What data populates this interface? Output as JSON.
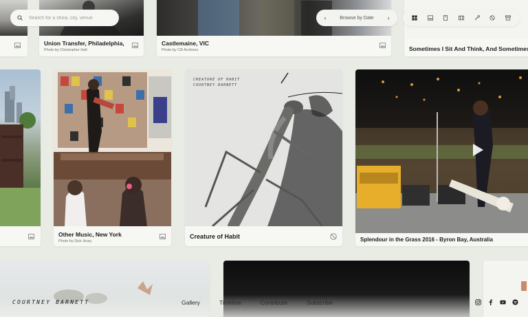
{
  "search": {
    "placeholder": "Search for a show, city, venue",
    "icon": "search-icon"
  },
  "date_nav": {
    "label": "Browse by Date",
    "prev": "‹",
    "next": "›"
  },
  "view_toolbar": [
    "grid-view-icon",
    "image-icon",
    "document-icon",
    "video-icon",
    "pen-icon",
    "no-icon",
    "archive-icon"
  ],
  "cards": {
    "union": {
      "title": "Union Transfer, Philadelphia, PA",
      "credit": "Photo by Christopher Hall"
    },
    "castlemaine": {
      "title": "Castlemaine, VIC",
      "credit": "Photo by CB Archives"
    },
    "sometimes": {
      "title": "Sometimes I Sit And Think, And Sometimes I Just Sit"
    },
    "othermusic": {
      "title": "Other Music, New York",
      "credit": "Photo by Dick Huey"
    },
    "creature": {
      "title": "Creature of Habit",
      "art_text_1": "CREATURE OF HABIT",
      "art_text_2": "COURTNEY BARNETT"
    },
    "splendour": {
      "title": "Splendour in the Grass 2016 - Byron Bay, Australia"
    }
  },
  "footer": {
    "logo": "COURTNEY BARNETT",
    "nav": [
      "Gallery",
      "Timeline",
      "Contribute",
      "Subscribe"
    ],
    "social": [
      "instagram-icon",
      "facebook-icon",
      "youtube-icon",
      "spotify-icon"
    ]
  }
}
